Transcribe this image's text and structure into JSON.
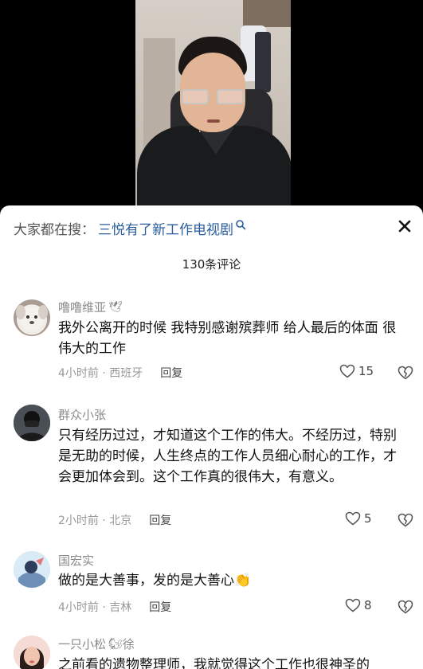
{
  "search": {
    "prefix": "大家都在搜：",
    "query": "三悦有了新工作电视剧"
  },
  "comment_count": "130条评论",
  "colors": {
    "link": "#2a5d9c",
    "muted": "#999999",
    "text": "#111111"
  },
  "comments": [
    {
      "user": "噜噜维亚",
      "user_emoji": "🕊",
      "text": "我外公离开的时候 我特别感谢殡葬师 给人最后的体面 很伟大的工作",
      "time": "4小时前 · 西班牙",
      "reply": "回复",
      "likes": "15"
    },
    {
      "user": "群众小张",
      "text": "只有经历过过，才知道这个工作的伟大。不经历过，特别是无助的时候，人生终点的工作人员细心耐心的工作，才会更加体会到。这个工作真的很伟大，有意义。",
      "time": "2小时前 · 北京",
      "reply": "回复",
      "likes": "5"
    },
    {
      "user": "国宏实",
      "text": "做的是大善事，发的是大善心",
      "text_emoji": "👏",
      "time": "4小时前 · 吉林",
      "reply": "回复",
      "likes": "8"
    },
    {
      "user": "一只小松",
      "user_emoji": "🐿",
      "user_suffix": "徐",
      "text": "之前看的遗物整理师，我就觉得这个工作也很神圣的"
    }
  ],
  "icons": {
    "close": "close-icon",
    "search": "search-icon",
    "like": "heart-icon",
    "dislike": "broken-heart-icon"
  }
}
